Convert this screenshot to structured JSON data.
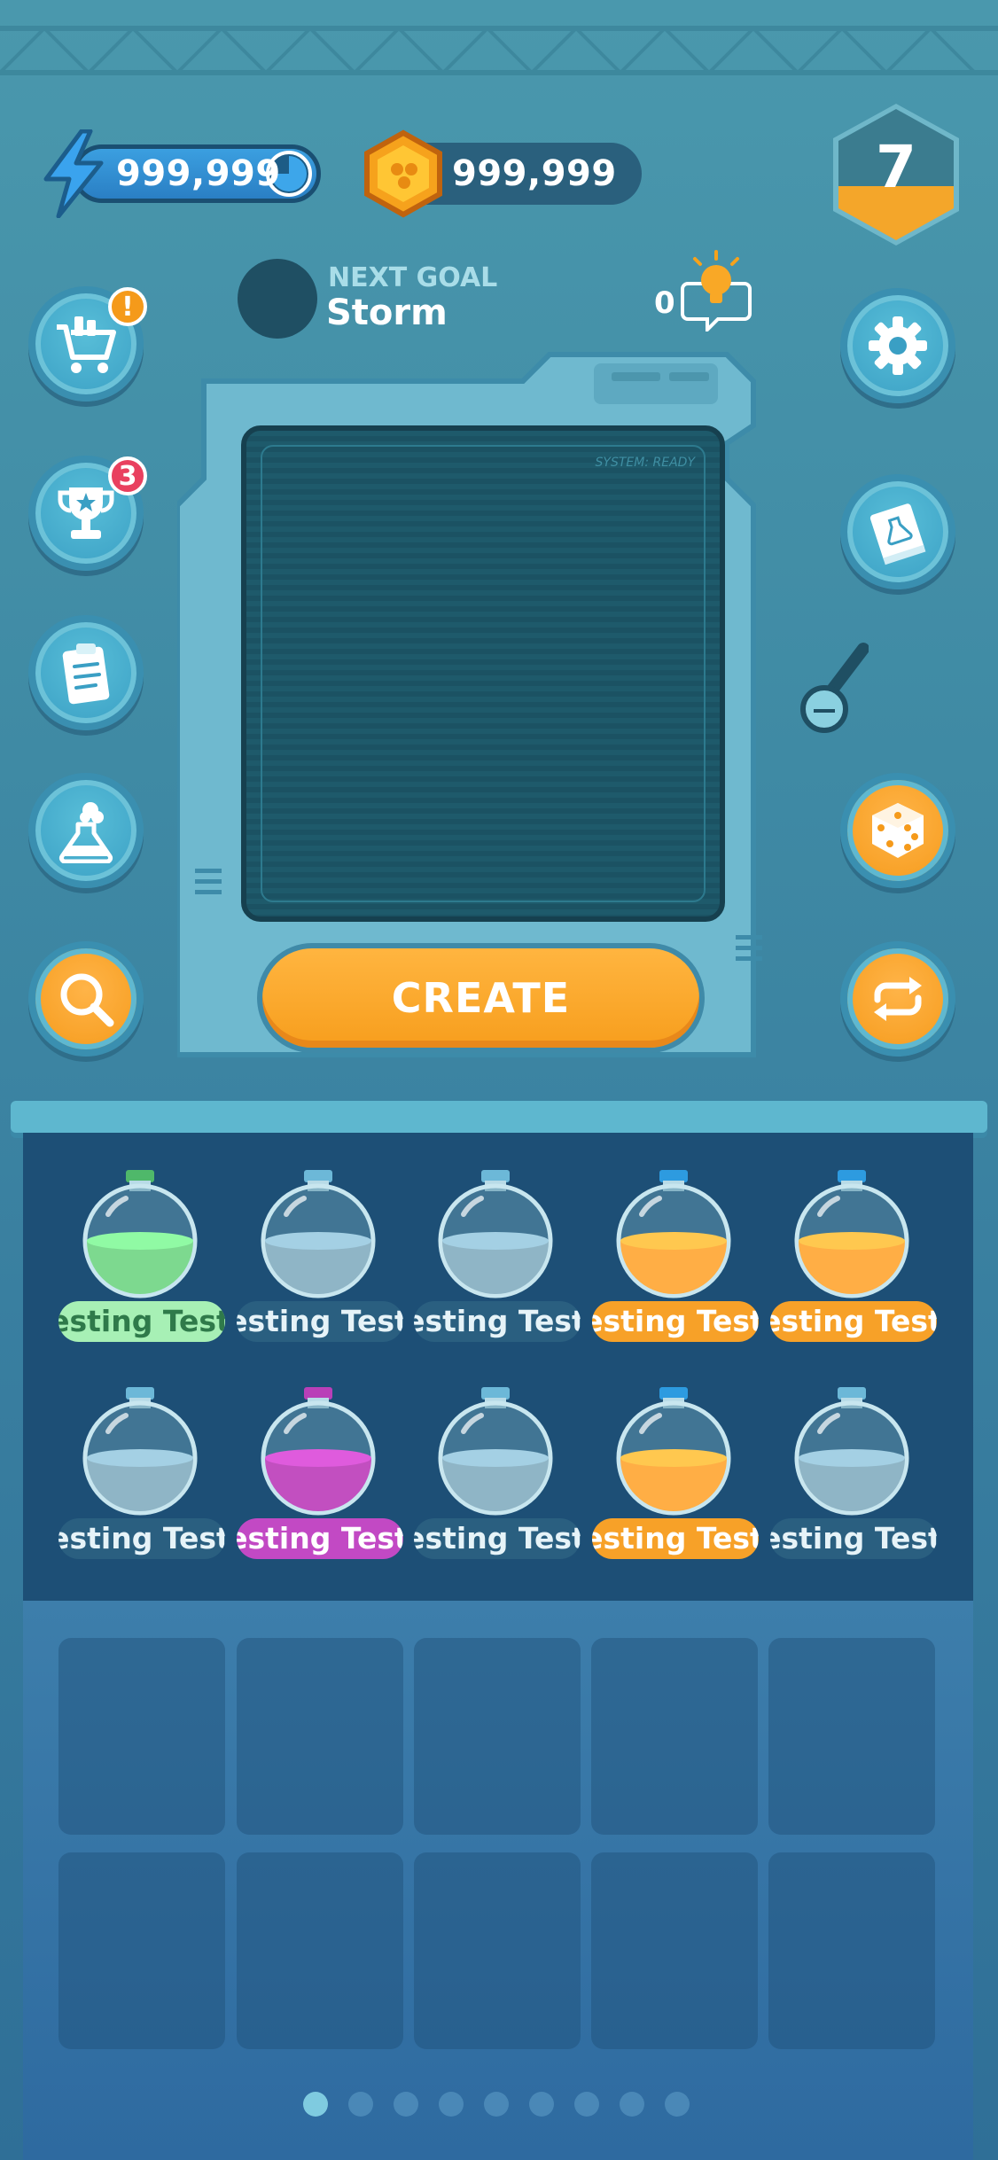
{
  "header": {
    "energy": {
      "value": "999,999",
      "icon": "lightning-icon"
    },
    "coins": {
      "value": "999,999",
      "icon": "coin-icon"
    },
    "level": "7"
  },
  "goal": {
    "label": "NEXT GOAL",
    "name": "Storm"
  },
  "hints": {
    "count": "0",
    "icon": "lightbulb-icon"
  },
  "left_buttons": [
    {
      "name": "shop-button",
      "icon": "cart-icon",
      "badge": "!"
    },
    {
      "name": "achievements-button",
      "icon": "trophy-icon",
      "badge": "3"
    },
    {
      "name": "quests-button",
      "icon": "clipboard-icon",
      "badge": ""
    },
    {
      "name": "lab-button",
      "icon": "flask-icon",
      "badge": ""
    },
    {
      "name": "search-button",
      "icon": "magnifier-icon",
      "badge": ""
    }
  ],
  "right_buttons": [
    {
      "name": "settings-button",
      "icon": "gear-icon"
    },
    {
      "name": "recipe-book-button",
      "icon": "book-icon"
    },
    {
      "name": "random-button",
      "icon": "dice-icon"
    },
    {
      "name": "swap-button",
      "icon": "refresh-icon"
    }
  ],
  "machine": {
    "screen_text": "SYSTEM: READY",
    "create_label": "CREATE"
  },
  "potions": [
    {
      "label": "Testing Testing",
      "color": "#7dd98f",
      "label_bg": "#a7f0b5",
      "label_color": "#2f7a4a",
      "cap": "#4fb86a"
    },
    {
      "label": "Testing Testing",
      "color": "#8fb5c6",
      "label_bg": "#2a5f80",
      "label_color": "#e6f3f8",
      "cap": "#6cb8d8"
    },
    {
      "label": "Testing Testing",
      "color": "#8fb5c6",
      "label_bg": "#2a5f80",
      "label_color": "#e6f3f8",
      "cap": "#6cb8d8"
    },
    {
      "label": "Testing Testing",
      "color": "#ffae45",
      "label_bg": "#f7a128",
      "label_color": "#ffffff",
      "cap": "#2d9be0"
    },
    {
      "label": "Testing Testing",
      "color": "#ffae45",
      "label_bg": "#f7a128",
      "label_color": "#ffffff",
      "cap": "#2d9be0"
    },
    {
      "label": "Testing Testing",
      "color": "#8fb5c6",
      "label_bg": "#2a5f80",
      "label_color": "#e6f3f8",
      "cap": "#6cb8d8"
    },
    {
      "label": "Testing Testing",
      "color": "#c24fc0",
      "label_bg": "#c249c4",
      "label_color": "#ffffff",
      "cap": "#b93fb8"
    },
    {
      "label": "Testing Testing",
      "color": "#8fb5c6",
      "label_bg": "#2a5f80",
      "label_color": "#e6f3f8",
      "cap": "#6cb8d8"
    },
    {
      "label": "Testing Testing",
      "color": "#ffae45",
      "label_bg": "#f7a128",
      "label_color": "#ffffff",
      "cap": "#2d9be0"
    },
    {
      "label": "Testing Testing",
      "color": "#8fb5c6",
      "label_bg": "#2a5f80",
      "label_color": "#e6f3f8",
      "cap": "#6cb8d8"
    }
  ],
  "pagination": {
    "total": 9,
    "active": 1
  }
}
